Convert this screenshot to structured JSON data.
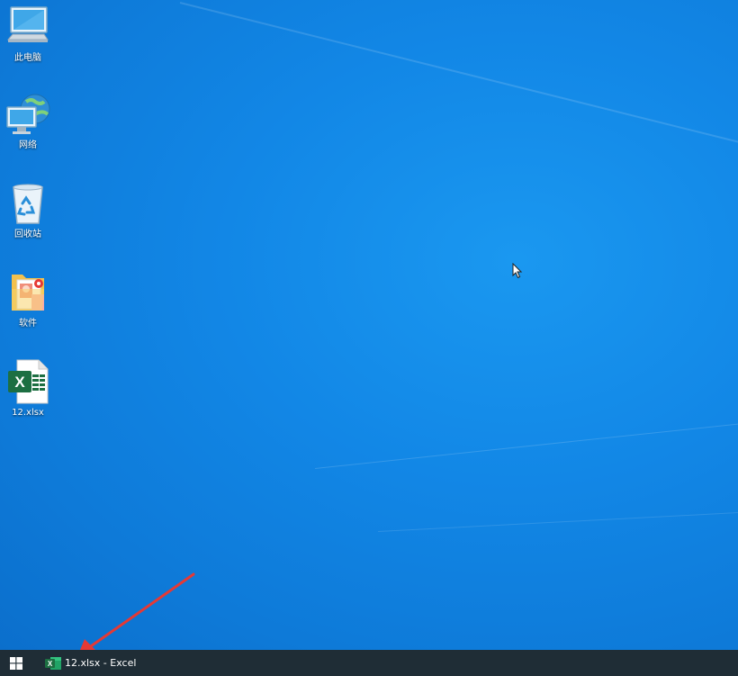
{
  "desktop": {
    "icons": [
      {
        "label": "此电脑",
        "icon": "this-pc-icon"
      },
      {
        "label": "网络",
        "icon": "network-icon"
      },
      {
        "label": "回收站",
        "icon": "recycle-bin-icon"
      },
      {
        "label": "软件",
        "icon": "folder-icon"
      },
      {
        "label": "12.xlsx",
        "icon": "excel-file-icon"
      }
    ]
  },
  "taskbar": {
    "start_icon": "windows-logo-icon",
    "open_app": {
      "label": "12.xlsx - Excel",
      "icon": "excel-icon"
    }
  },
  "colors": {
    "desktop_blue": "#1287e6",
    "taskbar": "#1f2d36",
    "excel_green": "#1d6f42",
    "annotation_red": "#e53935"
  }
}
